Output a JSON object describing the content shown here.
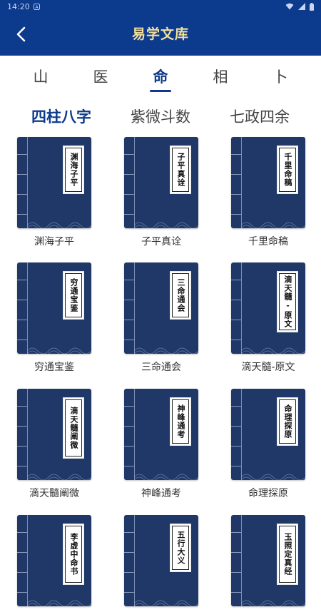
{
  "status_bar": {
    "time": "14:20"
  },
  "app_bar": {
    "title": "易学文库"
  },
  "tabs": [
    "山",
    "医",
    "命",
    "相",
    "卜"
  ],
  "active_tab": 2,
  "subtabs": [
    "四柱八字",
    "紫微斗数",
    "七政四余"
  ],
  "active_subtab": 0,
  "books": [
    {
      "title": "渊海子平",
      "cover": "渊海子平"
    },
    {
      "title": "子平真诠",
      "cover": "子平真诠"
    },
    {
      "title": "千里命稿",
      "cover": "千里命稿"
    },
    {
      "title": "穷通宝鉴",
      "cover": "穷通宝鉴"
    },
    {
      "title": "三命通会",
      "cover": "三命通会"
    },
    {
      "title": "滴天髓-原文",
      "cover": "滴天髓-原文"
    },
    {
      "title": "滴天髓阐微",
      "cover": "滴天髓阐微"
    },
    {
      "title": "神峰通考",
      "cover": "神峰通考"
    },
    {
      "title": "命理探原",
      "cover": "命理探原"
    },
    {
      "title": "",
      "cover": "李虚中命书"
    },
    {
      "title": "",
      "cover": "五行大义"
    },
    {
      "title": "",
      "cover": "玉照定真经"
    }
  ],
  "colors": {
    "primary": "#0c3a8c",
    "title_gold": "#f3de9a",
    "cover": "#1f3868"
  }
}
